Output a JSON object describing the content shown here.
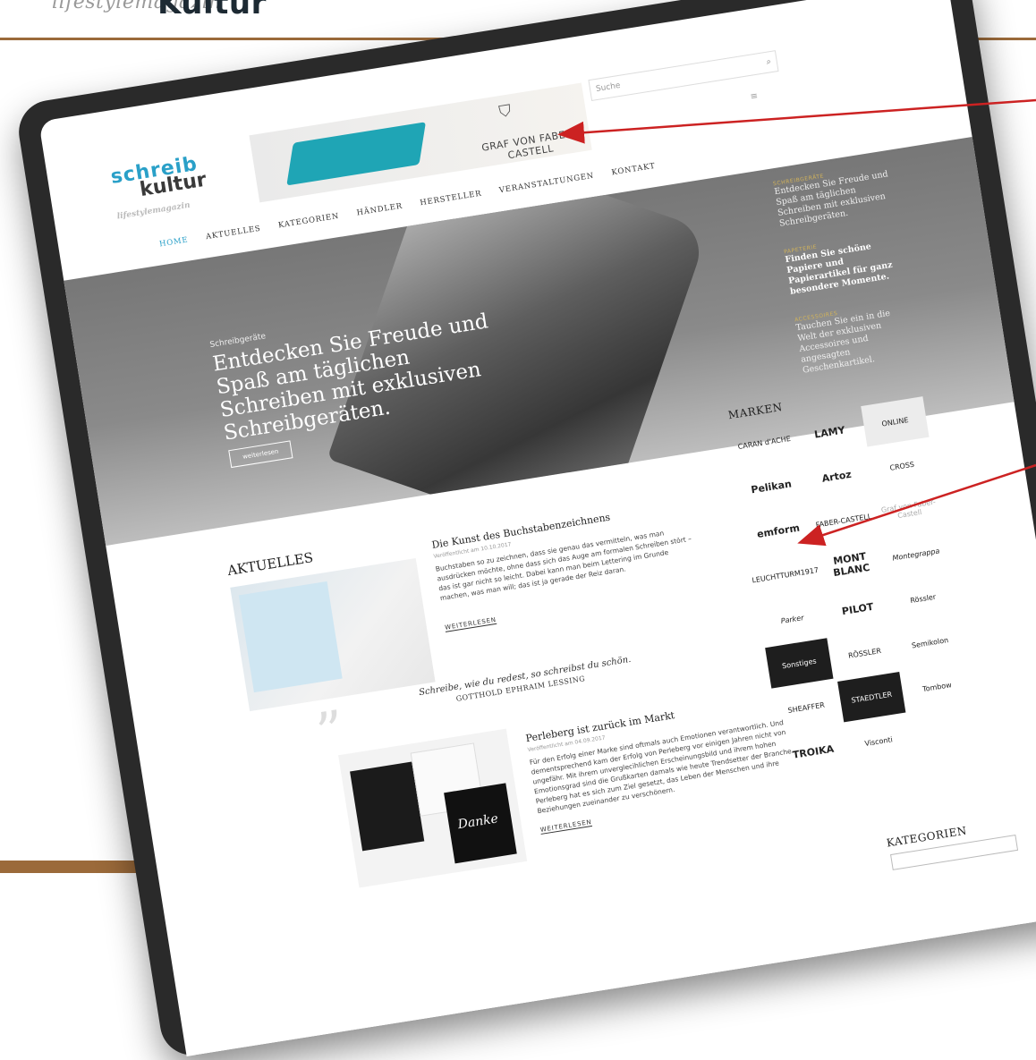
{
  "page": {
    "top_logo_script": "lifestylemagazin",
    "top_logo_word": "Kultur",
    "arrow_color": "#cc2222"
  },
  "site": {
    "logo_line1": "schreib",
    "logo_line2": "kultur",
    "logo_tag": "lifestylemagazin",
    "banner_brand": "GRAF VON FABER-CASTELL",
    "banner_crest": "⛉",
    "search_placeholder": "Suche",
    "search_icon": "search-icon",
    "menu_icon": "hamburger-icon",
    "accent": "#2aa0c8",
    "nav": [
      "HOME",
      "AKTUELLES",
      "KATEGORIEN",
      "HÄNDLER",
      "HERSTELLER",
      "VERANSTALTUNGEN",
      "KONTAKT"
    ]
  },
  "hero": {
    "kicker": "Schreibgeräte",
    "title": "Entdecken Sie Freude und Spaß am täglichen Schreiben mit exklusiven Schreibgeräten.",
    "button": "weiterlesen",
    "side": [
      {
        "kicker": "SCHREIBGERÄTE",
        "text": "Entdecken Sie Freude und Spaß am täglichen Schreiben mit exklusiven Schreibgeräten."
      },
      {
        "kicker": "PAPETERIE",
        "text": "Finden Sie schöne Papiere und Papierartikel für ganz besondere Momente."
      },
      {
        "kicker": "ACCESSOIRES",
        "text": "Tauchen Sie ein in die Welt der exklusiven Accessoires und angesagten Geschenkartikel."
      }
    ]
  },
  "aktuelles": {
    "heading": "AKTUELLES",
    "post1": {
      "title": "Die Kunst des Buchstabenzeichnens",
      "date": "Veröffentlicht am 10.10.2017",
      "text": "Buchstaben so zu zeichnen, dass sie genau das vermitteln, was man ausdrücken möchte, ohne dass sich das Auge am formalen Schreiben stört – das ist gar nicht so leicht. Dabei kann man beim Lettering im Grunde machen, was man will; das ist ja gerade der Reiz daran.",
      "more": "WEITERLESEN"
    },
    "quote": {
      "text": "Schreibe, wie du redest, so schreibst du schön.",
      "author": "GOTTHOLD EPHRAIM LESSING"
    },
    "post2": {
      "title": "Perleberg ist zurück im Markt",
      "date": "Veröffentlicht am 04.09.2017",
      "text": "Für den Erfolg einer Marke sind oftmals auch Emotionen verantwortlich. Und dementsprechend kam der Erfolg von Perleberg vor einigen Jahren nicht von ungefähr. Mit ihrem unverglecihlichen Erscheinungsbild und ihrem hohen Emotionsgrad sind die Grußkarten damals wie heute Trendsetter der Branche. Perleberg hat es sich zum Ziel gesetzt, das Leben der Menschen und ihre Beziehungen zueinander zu verschönern.",
      "more": "WEITERLESEN",
      "card_text": "Danke"
    }
  },
  "marken": {
    "heading": "MARKEN",
    "brands": [
      "CARAN d'ACHE",
      "LAMY",
      "ONLINE",
      "Pelikan",
      "Artoz",
      "CROSS",
      "emform",
      "FABER-CASTELL",
      "Graf von Faber-Castell",
      "LEUCHTTURM1917",
      "MONT BLANC",
      "Montegrappa",
      "Parker",
      "PILOT",
      "Rössler",
      "Sonstiges",
      "RÖSSLER",
      "Semikolon",
      "SHEAFFER",
      "STAEDTLER",
      "Tombow",
      "TROIKA",
      "Visconti"
    ]
  },
  "kategorien": {
    "heading": "KATEGORIEN"
  }
}
